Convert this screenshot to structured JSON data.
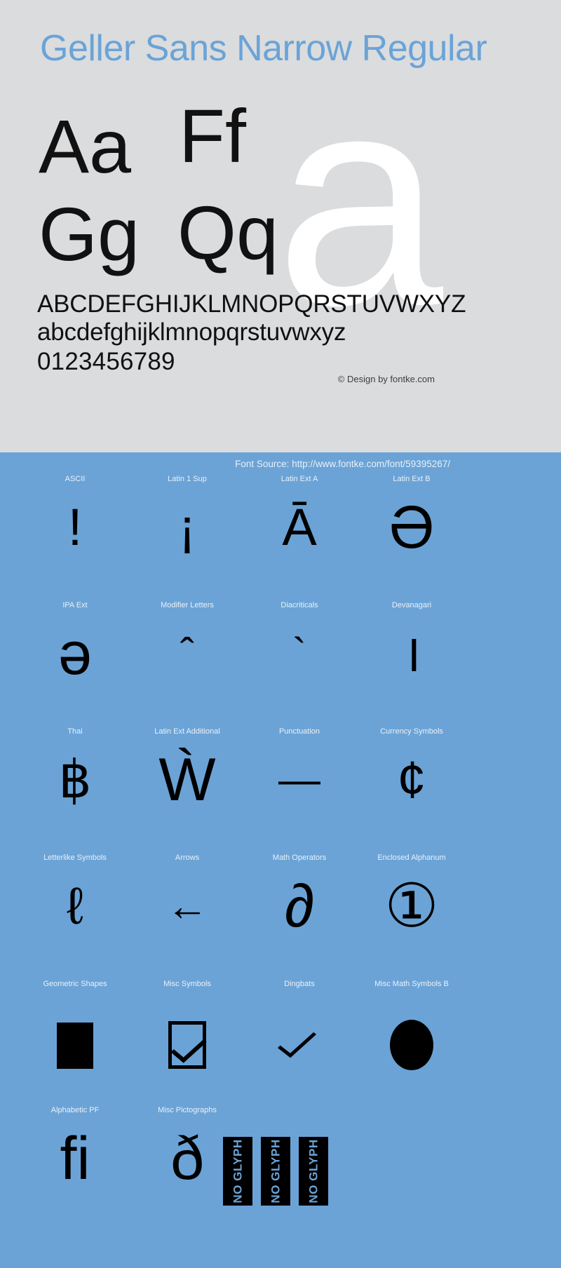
{
  "specimen": {
    "title": "Geller Sans Narrow Regular",
    "watermark_glyph": "a",
    "sample_pairs": [
      "Aa",
      "Ff",
      "Gg",
      "Qq"
    ],
    "alphabet_upper": "ABCDEFGHIJKLMNOPQRSTUVWXYZ",
    "alphabet_lower": "abcdefghijklmnopqrstuvwxyz",
    "digits": "0123456789",
    "copyright": "© Design by fontke.com",
    "font_source": "Font Source: http://www.fontke.com/font/59395267/"
  },
  "colors": {
    "top_background": "#dadcde",
    "blue_background": "#6ba3d6",
    "title_blue": "#6ba3d6",
    "glyph_black": "#000000",
    "label_white": "#eaf1f8"
  },
  "unicode_blocks": {
    "rows": [
      {
        "cells": [
          {
            "label": "ASCII",
            "glyph": "!"
          },
          {
            "label": "Latin 1 Sup",
            "glyph": "¡"
          },
          {
            "label": "Latin Ext A",
            "glyph": "Ā"
          },
          {
            "label": "Latin Ext B",
            "glyph": "Ə"
          }
        ]
      },
      {
        "cells": [
          {
            "label": "IPA Ext",
            "glyph": "ə"
          },
          {
            "label": "Modifier Letters",
            "glyph": "ˆ"
          },
          {
            "label": "Diacriticals",
            "glyph": "`"
          },
          {
            "label": "Devanagari",
            "glyph": "।"
          }
        ]
      },
      {
        "cells": [
          {
            "label": "Thai",
            "glyph": "฿"
          },
          {
            "label": "Latin Ext Additional",
            "glyph": "Ẁ"
          },
          {
            "label": "Punctuation",
            "glyph": "—"
          },
          {
            "label": "Currency Symbols",
            "glyph": "¢"
          }
        ]
      },
      {
        "cells": [
          {
            "label": "Letterlike Symbols",
            "glyph": "ℓ"
          },
          {
            "label": "Arrows",
            "glyph": "←"
          },
          {
            "label": "Math Operators",
            "glyph": "∂"
          },
          {
            "label": "Enclosed Alphanum",
            "glyph": "①"
          }
        ]
      },
      {
        "cells": [
          {
            "label": "Geometric Shapes",
            "glyph": "■"
          },
          {
            "label": "Misc Symbols",
            "glyph": "☑"
          },
          {
            "label": "Dingbats",
            "glyph": "✓"
          },
          {
            "label": "Misc Math Symbols B",
            "glyph": "⬤"
          }
        ]
      },
      {
        "cells": [
          {
            "label": "Alphabetic PF",
            "glyph": "ﬁ"
          },
          {
            "label": "Misc Pictographs",
            "glyph": "ð"
          }
        ]
      }
    ],
    "no_glyph_label": "NO GLYPH",
    "no_glyph_count": 3
  }
}
